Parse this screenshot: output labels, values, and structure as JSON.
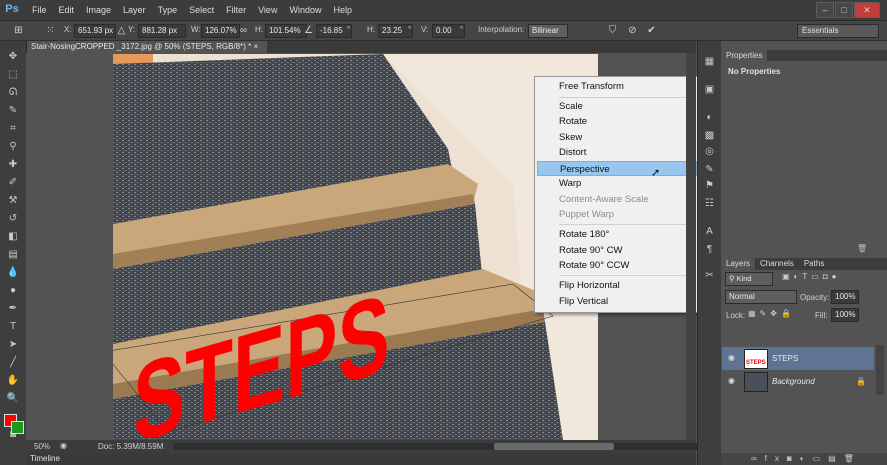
{
  "app": {
    "logo": "Ps"
  },
  "menu": [
    "File",
    "Edit",
    "Image",
    "Layer",
    "Type",
    "Select",
    "Filter",
    "View",
    "Window",
    "Help"
  ],
  "window_controls": {
    "minimize": "–",
    "maximize": "□",
    "close": "✕"
  },
  "options": {
    "x_label": "X:",
    "x_value": "651.93 px",
    "y_label": "Y:",
    "y_value": "881.28 px",
    "w_label": "W:",
    "w_value": "126.07%",
    "h_label": "H:",
    "h_value": "101.54%",
    "angle_value": "-16.85",
    "deg": "°",
    "hskew_label": "H:",
    "hskew_value": "23.25",
    "vskew_label": "V:",
    "vskew_value": "0.00",
    "interp_label": "Interpolation:",
    "interp_value": "Bilinear",
    "workspace": "Essentials"
  },
  "document": {
    "tab_title": "Stair-NosingCROPPED _3172.jpg @ 50% (STEPS, RGB/8*) *",
    "canvas_text": "STEPS"
  },
  "context_menu": {
    "items": [
      {
        "label": "Free Transform",
        "disabled": false
      },
      {
        "label": "Scale",
        "disabled": false
      },
      {
        "label": "Rotate",
        "disabled": false
      },
      {
        "label": "Skew",
        "disabled": false
      },
      {
        "label": "Distort",
        "disabled": false
      },
      {
        "label": "Perspective",
        "disabled": false,
        "highlighted": true
      },
      {
        "label": "Warp",
        "disabled": false
      },
      {
        "label": "Content-Aware Scale",
        "disabled": true
      },
      {
        "label": "Puppet Warp",
        "disabled": true
      },
      {
        "label": "Rotate 180°",
        "disabled": false
      },
      {
        "label": "Rotate 90° CW",
        "disabled": false
      },
      {
        "label": "Rotate 90° CCW",
        "disabled": false
      },
      {
        "label": "Flip Horizontal",
        "disabled": false
      },
      {
        "label": "Flip Vertical",
        "disabled": false
      }
    ]
  },
  "status": {
    "zoom": "50%",
    "doc": "Doc: 5.39M/8.59M"
  },
  "timeline_label": "Timeline",
  "properties": {
    "tab": "Properties",
    "body": "No Properties"
  },
  "layers": {
    "tabs": [
      "Layers",
      "Channels",
      "Paths"
    ],
    "kind": "Kind",
    "blend": "Normal",
    "opacity_label": "Opacity:",
    "opacity_value": "100%",
    "lock_label": "Lock:",
    "fill_label": "Fill:",
    "fill_value": "100%",
    "items": [
      {
        "name": "STEPS",
        "selected": true
      },
      {
        "name": "Background",
        "selected": false
      }
    ]
  },
  "colors": {
    "foreground": "#ff0000",
    "background": "#1a9a1a",
    "highlight": "#97c7ee",
    "selected_layer": "#5f7493"
  }
}
